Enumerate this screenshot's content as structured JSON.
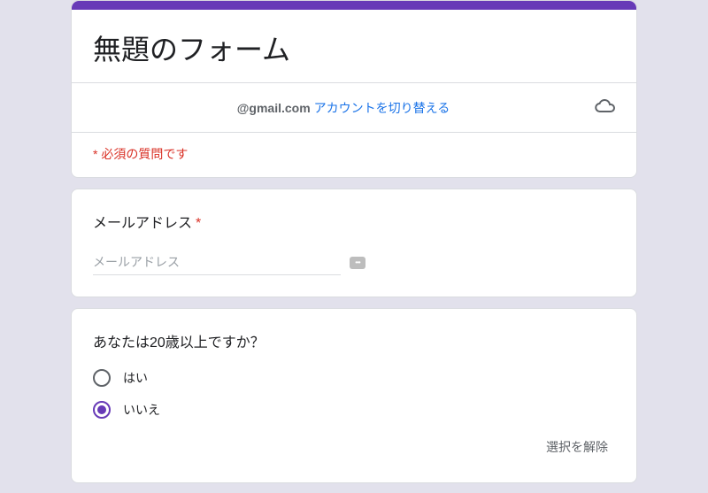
{
  "header": {
    "title": "無題のフォーム",
    "account_email": "@gmail.com",
    "switch_account_label": "アカウントを切り替える",
    "required_notice": "* 必須の質問です"
  },
  "email_question": {
    "label": "メールアドレス",
    "placeholder": "メールアドレス"
  },
  "age_question": {
    "label": "あなたは20歳以上ですか？",
    "options": {
      "yes": "はい",
      "no": "いいえ"
    },
    "selected": "no",
    "clear_label": "選択を解除"
  }
}
